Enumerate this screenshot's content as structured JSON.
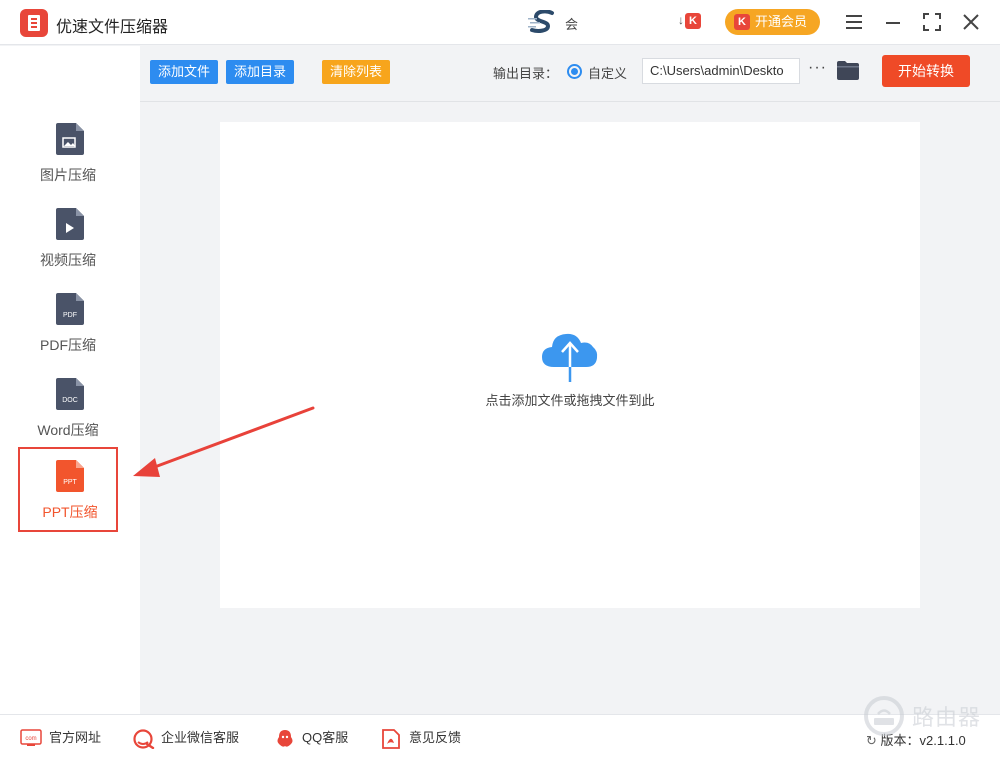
{
  "titlebar": {
    "app_title": "优速文件压缩器",
    "user_name": "会",
    "vip_small_prefix": "↓",
    "vip_k": "K",
    "vip_button_label": "开通会员"
  },
  "sidebar": {
    "items": [
      {
        "label": "图片压缩",
        "badge": ""
      },
      {
        "label": "视频压缩",
        "badge": ""
      },
      {
        "label": "PDF压缩",
        "badge": "PDF"
      },
      {
        "label": "Word压缩",
        "badge": "DOC"
      },
      {
        "label": "PPT压缩",
        "badge": "PPT",
        "active": true
      }
    ]
  },
  "toolbar": {
    "add_file": "添加文件",
    "add_dir": "添加目录",
    "clear_list": "清除列表",
    "output_label": "输出目录：",
    "custom_label": "自定义",
    "output_path": "C:\\Users\\admin\\Deskto",
    "more": "···",
    "start": "开始转换"
  },
  "dropzone": {
    "hint": "点击添加文件或拖拽文件到此"
  },
  "footer": {
    "website_icon_text": "com",
    "website": "官方网址",
    "wechat": "企业微信客服",
    "qq": "QQ客服",
    "feedback": "意见反馈",
    "version": "版本：v2.1.1.0",
    "watermark": "路由器"
  },
  "colors": {
    "primary_blue": "#2d8cf0",
    "orange": "#f7a51c",
    "start_red": "#ef4a27",
    "active_red": "#e8463a",
    "icon_gray": "#4a5368"
  }
}
